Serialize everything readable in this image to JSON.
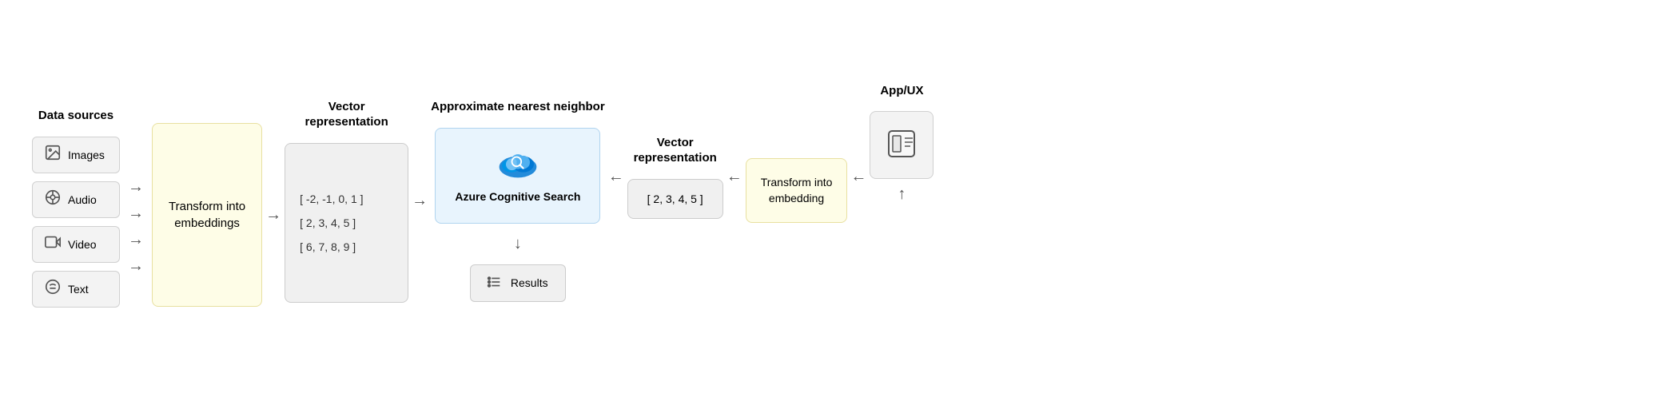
{
  "datasources": {
    "label": "Data sources",
    "items": [
      {
        "id": "images",
        "label": "Images",
        "icon": "🖼"
      },
      {
        "id": "audio",
        "label": "Audio",
        "icon": "🎧"
      },
      {
        "id": "video",
        "label": "Video",
        "icon": "🎬"
      },
      {
        "id": "text",
        "label": "Text",
        "icon": "💬"
      }
    ]
  },
  "transform_left": {
    "label": "Transform into\nembeddings"
  },
  "vector_left": {
    "label": "Vector\nrepresentation",
    "rows": [
      "[ -2, -1, 0, 1 ]",
      "[ 2, 3, 4, 5 ]",
      "[ 6, 7, 8, 9 ]"
    ]
  },
  "ann": {
    "label": "Approximate\nnearest neighbor"
  },
  "azure": {
    "label": "Azure Cognitive\nSearch"
  },
  "results": {
    "label": "Results"
  },
  "vector_right": {
    "label": "Vector\nrepresentation",
    "value": "[ 2, 3, 4, 5 ]"
  },
  "transform_right": {
    "label": "Transform into\nembedding"
  },
  "appux": {
    "label": "App/UX"
  }
}
